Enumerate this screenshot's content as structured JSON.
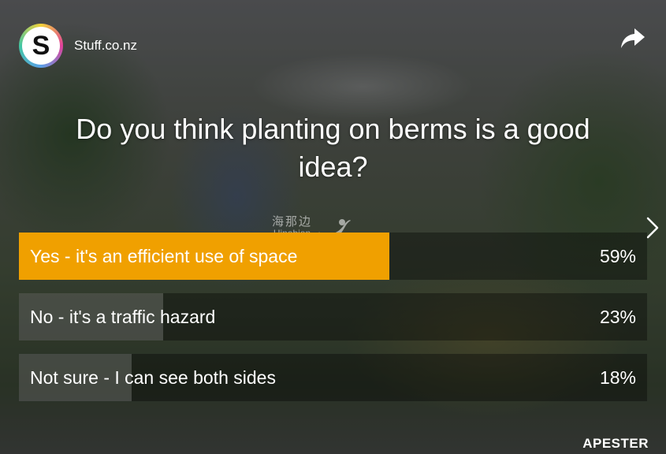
{
  "brand": {
    "name": "Stuff.co.nz",
    "logo_letter": "S",
    "logo_icon": "stuff-logo-icon"
  },
  "header": {
    "share_icon": "share-arrow-icon"
  },
  "poll": {
    "question": "Do you think planting on berms is a good idea?",
    "answers": [
      {
        "label": "Yes - it's an efficient use of space",
        "percent_label": "59%",
        "percent": 59,
        "color": "#f0a000",
        "selected": true
      },
      {
        "label": "No - it's a traffic hazard",
        "percent_label": "23%",
        "percent": 23,
        "color": "#ffffff",
        "selected": false
      },
      {
        "label": "Not sure - I can see both sides",
        "percent_label": "18%",
        "percent": 18,
        "color": "#ffffff",
        "selected": false
      }
    ]
  },
  "watermark": {
    "chinese": "海那边",
    "english": "Hinabian"
  },
  "navigation": {
    "next_icon": "chevron-right-icon"
  },
  "footer": {
    "powered_by": "APESTER"
  }
}
